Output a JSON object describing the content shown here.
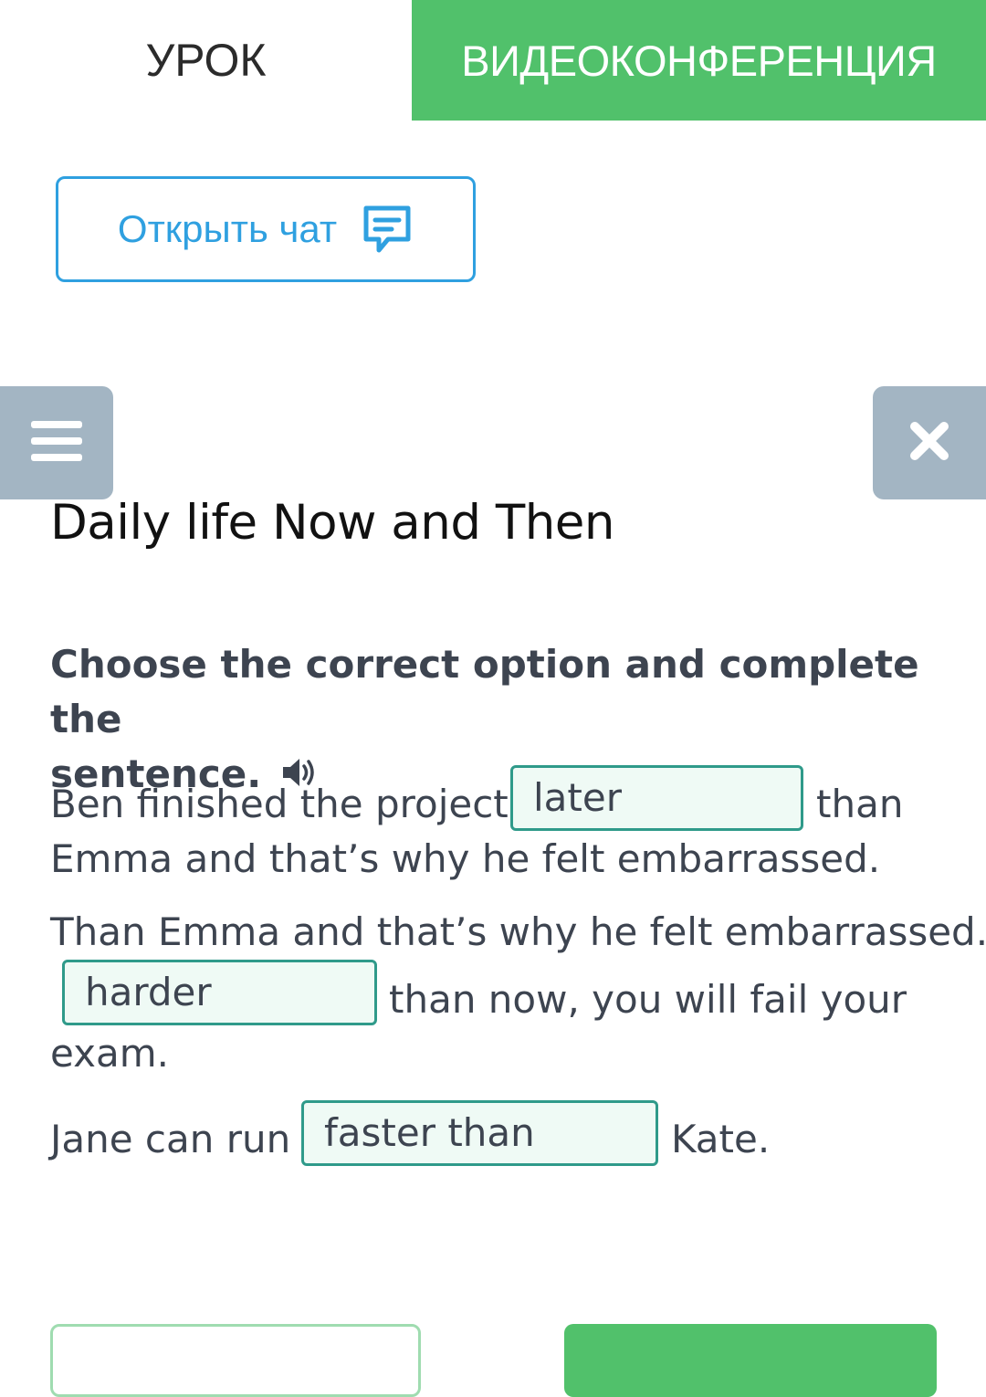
{
  "tabs": {
    "lesson": "УРОК",
    "videoconference": "ВИДЕОКОНФЕРЕНЦИЯ"
  },
  "chat": {
    "label": "Открыть чат",
    "icon": "chat-bubble-icon"
  },
  "controls": {
    "menu_icon": "hamburger-menu-icon",
    "close_icon": "close-icon"
  },
  "lesson": {
    "title": "Daily life Now and Then",
    "instruction_line1": "Choose the correct option and complete the",
    "instruction_line2": "sentence."
  },
  "sentences": [
    {
      "before": "Ben finished the project",
      "answer": "later",
      "after": "than",
      "continuation": "Emma and that’s why he felt embarrassed."
    },
    {
      "before": "Than Emma and that’s why he felt embarrassed.",
      "answer": "harder",
      "after": "than now, you will fail your",
      "continuation": "exam."
    },
    {
      "before": "Jane can run",
      "answer": "faster than",
      "after": "Kate."
    }
  ],
  "colors": {
    "green": "#51c16b",
    "blue": "#2fa0e0",
    "gray": "#a3b5c3",
    "teal": "#2f9a8a"
  }
}
